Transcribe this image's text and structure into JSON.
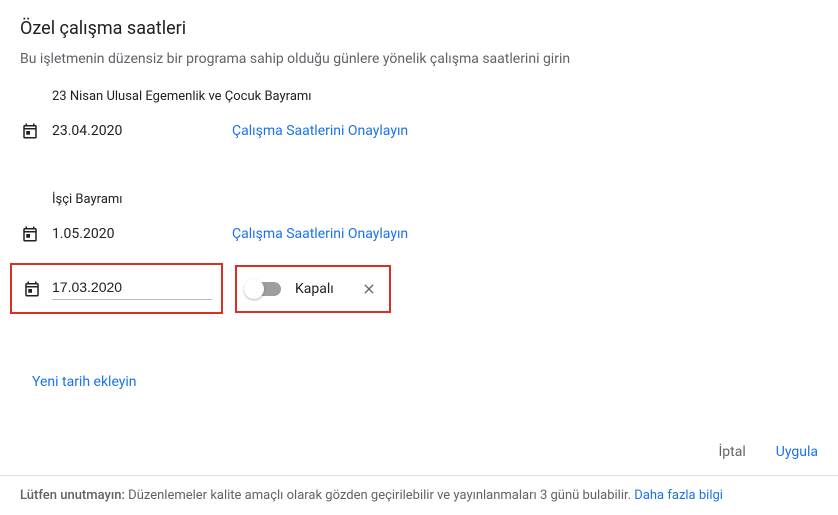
{
  "title": "Özel çalışma saatleri",
  "subtitle": "Bu işletmenin düzensiz bir programa sahip olduğu günlere yönelik çalışma saatlerini girin",
  "entries": [
    {
      "label": "23 Nisan Ulusal Egemenlik ve Çocuk Bayramı",
      "date": "23.04.2020",
      "confirm": "Çalışma Saatlerini Onaylayın"
    },
    {
      "label": "İşçi Bayramı",
      "date": "1.05.2020",
      "confirm": "Çalışma Saatlerini Onaylayın"
    }
  ],
  "custom": {
    "date": "17.03.2020",
    "closed_label": "Kapalı"
  },
  "add_date": "Yeni tarih ekleyin",
  "actions": {
    "cancel": "İptal",
    "apply": "Uygula"
  },
  "footer": {
    "prefix": "Lütfen unutmayın:",
    "text": " Düzenlemeler kalite amaçlı olarak gözden geçirilebilir ve yayınlanmaları 3 günü bulabilir. ",
    "link": "Daha fazla bilgi"
  }
}
